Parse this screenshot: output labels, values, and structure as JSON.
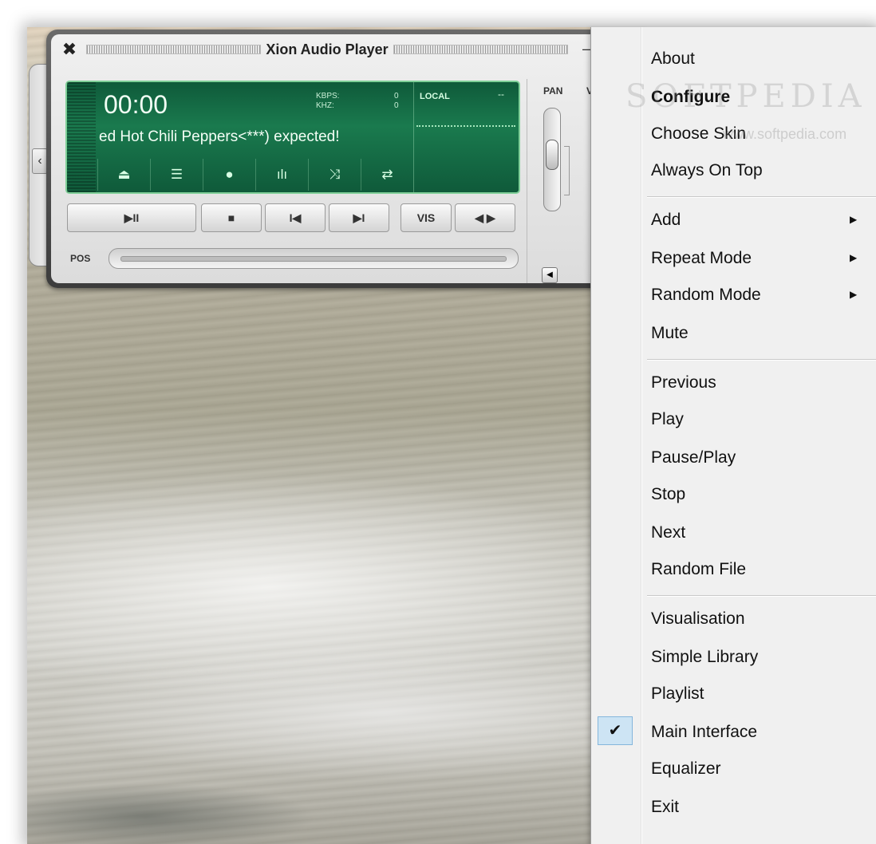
{
  "player": {
    "title": "Xion Audio Player",
    "minimize": "–",
    "restore": "▭",
    "time": "00:00",
    "kbps_label": "KBPS:",
    "khz_label": "KHZ:",
    "kbps_value": "0",
    "khz_value": "0",
    "source": "LOCAL",
    "source_dash": "--",
    "song": "ed Hot Chili Peppers<***) expected!",
    "lcd_buttons": [
      "⏏",
      "☰",
      "●",
      "ılı",
      "⤨",
      "⇄"
    ],
    "controls": {
      "play_pause": "▶II",
      "stop": "■",
      "prev": "I◀",
      "next": "▶I",
      "vis": "VIS",
      "vis_arrows": "◀ ▶"
    },
    "pos_label": "POS",
    "pan_label": "PAN",
    "v_label": "V"
  },
  "menu": {
    "items": [
      {
        "label": "About"
      },
      {
        "label": "Configure",
        "bold": true
      },
      {
        "label": "Choose Skin"
      },
      {
        "label": "Always On Top"
      },
      {
        "label": "Add",
        "submenu": true
      },
      {
        "label": "Repeat Mode",
        "submenu": true
      },
      {
        "label": "Random Mode",
        "submenu": true
      },
      {
        "label": "Mute"
      },
      {
        "label": "Previous"
      },
      {
        "label": "Play"
      },
      {
        "label": "Pause/Play"
      },
      {
        "label": "Stop"
      },
      {
        "label": "Next"
      },
      {
        "label": "Random File"
      },
      {
        "label": "Visualisation"
      },
      {
        "label": "Simple Library"
      },
      {
        "label": "Playlist"
      },
      {
        "label": "Main Interface",
        "checked": true
      },
      {
        "label": "Equalizer"
      },
      {
        "label": "Exit"
      }
    ],
    "submenu_arrow": "▶",
    "check_mark": "✔"
  },
  "watermark": {
    "brand": "SOFTPEDIA",
    "url": "www.softpedia.com"
  }
}
